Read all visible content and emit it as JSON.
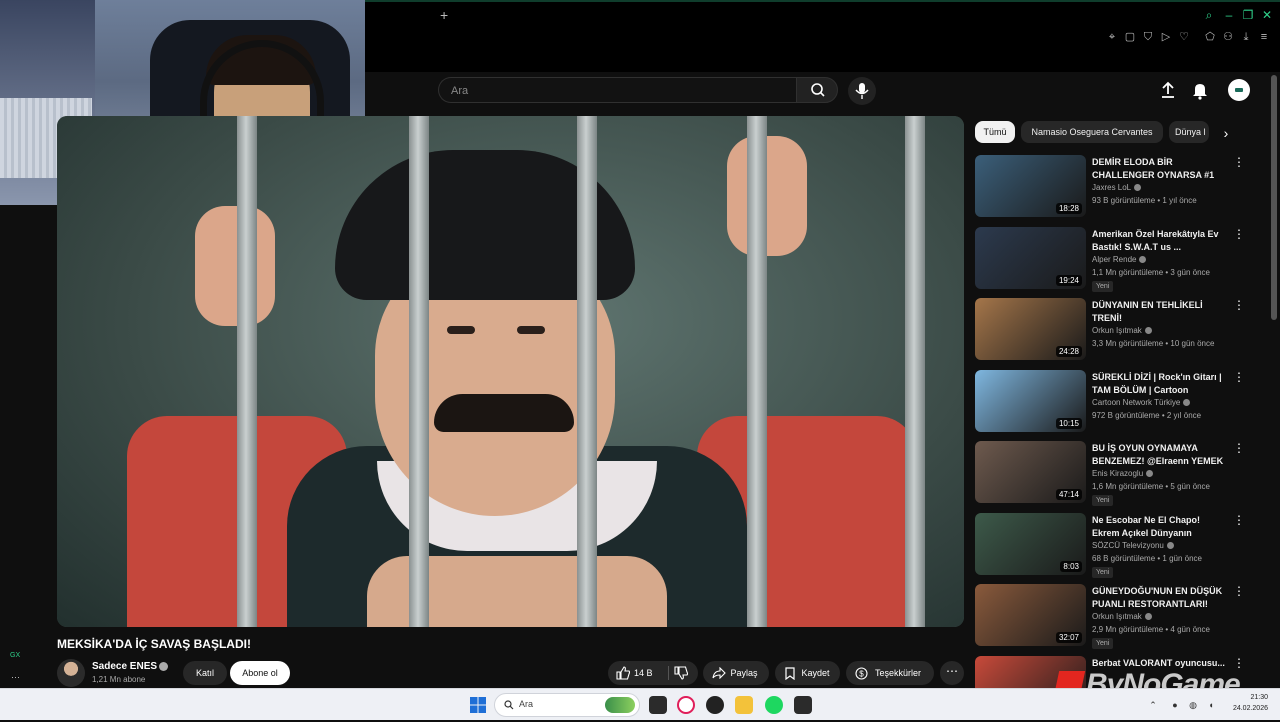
{
  "header": {
    "search_placeholder": "Ara"
  },
  "video": {
    "title": "MEKSİKA'DA İÇ SAVAŞ BAŞLADI!",
    "channel": "Sadece ENES",
    "subscribers": "1,21 Mn abone",
    "join_label": "Katıl",
    "subscribe_label": "Abone ol",
    "likes": "14 B",
    "share_label": "Paylaş",
    "save_label": "Kaydet",
    "thanks_label": "Teşekkürler",
    "more_label": "⋯"
  },
  "chips": [
    "Tümü",
    "Namasio Oseguera Cervantes",
    "Dünya l"
  ],
  "recommendations": [
    {
      "title": "DEMİR ELODA BİR CHALLENGER OYNARSA #1",
      "channel": "Jaxres LoL",
      "meta": "93 B görüntüleme • 1 yıl önce",
      "duration": "18:28",
      "badge": "",
      "thumb_color": "#3b5f7a"
    },
    {
      "title": "Amerikan Özel Harekâtıyla Ev Bastık! S.W.A.T us ...",
      "channel": "Alper Rende",
      "meta": "1,1 Mn görüntüleme • 3 gün önce",
      "duration": "19:24",
      "badge": "Yeni",
      "thumb_color": "#2c3a4e"
    },
    {
      "title": "DÜNYANIN EN TEHLİKELİ TRENİ!",
      "channel": "Orkun Işıtmak",
      "meta": "3,3 Mn görüntüleme • 10 gün önce",
      "duration": "24:28",
      "badge": "",
      "thumb_color": "#a5764a"
    },
    {
      "title": "SÜREKLİ DİZİ | Rock'ın Gitarı | TAM BÖLÜM | Cartoon Network...",
      "channel": "Cartoon Network Türkiye",
      "meta": "972 B görüntüleme • 2 yıl önce",
      "duration": "10:15",
      "badge": "",
      "thumb_color": "#7fb7e0"
    },
    {
      "title": "BU İŞ OYUN OYNAMAYA BENZEMEZ! @Elraenn YEMEK ...",
      "channel": "Enis Kirazoglu",
      "meta": "1,6 Mn görüntüleme • 5 gün önce",
      "duration": "47:14",
      "badge": "Yeni",
      "thumb_color": "#6e5a4e"
    },
    {
      "title": "Ne Escobar Ne El Chapo! Ekrem Açıkel Dünyanın Konuştuğu O ...",
      "channel": "SÖZCÜ Televizyonu",
      "meta": "68 B görüntüleme • 1 gün önce",
      "duration": "8:03",
      "badge": "Yeni",
      "thumb_color": "#3d5a4a"
    },
    {
      "title": "GÜNEYDOĞU'NUN EN DÜŞÜK PUANLI RESTORANTLARI!",
      "channel": "Orkun Işıtmak",
      "meta": "2,9 Mn görüntüleme • 4 gün önce",
      "duration": "32:07",
      "badge": "Yeni",
      "thumb_color": "#8a5a3c"
    },
    {
      "title": "Berbat VALORANT oyuncusu...",
      "channel": "",
      "meta": "",
      "duration": "",
      "badge": "",
      "thumb_color": "#c84a3a"
    }
  ],
  "left_strip": {
    "gx_label": "GX",
    "dots": "···"
  },
  "watermark": "ByNoGame",
  "taskbar": {
    "search_label": "Ara",
    "time": "21:30",
    "date": "24.02.2026"
  },
  "colors": {
    "accent": "#2fd08a",
    "background": "#0f0f0f",
    "watermark_red": "#e3261f"
  }
}
